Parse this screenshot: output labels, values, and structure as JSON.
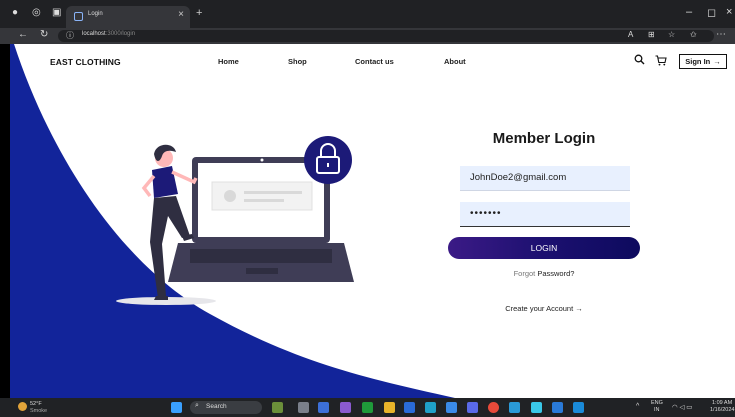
{
  "browser": {
    "tab_title": "Login",
    "tab_close": "×",
    "new_tab": "+",
    "url_host": "localhost",
    "url_path": ":3000/login",
    "min": "–",
    "max": "◻",
    "close": "×"
  },
  "nav": {
    "brand": "EAST CLOTHING",
    "links": [
      "Home",
      "Shop",
      "Contact us",
      "About"
    ],
    "signin_label": "Sign In",
    "signin_arrow": "→"
  },
  "login": {
    "title": "Member Login",
    "email_value": "JohnDoe2@gmail.com",
    "password_value": "•••••••",
    "button_label": "LOGIN",
    "forgot_prefix": "Forgot",
    "forgot_suffix": " Password?",
    "create_account": "Create your Account →"
  },
  "taskbar": {
    "weather_temp": "52°F",
    "weather_desc": "Smoke",
    "search_label": "Search",
    "lang_top": "ENG",
    "lang_bottom": "IN",
    "time": "1:09 AM",
    "date": "1/16/2024"
  },
  "colors": {
    "brand_blue": "#12249a",
    "accent_purple": "#2d1585",
    "field_bg": "#e8f0fe"
  }
}
